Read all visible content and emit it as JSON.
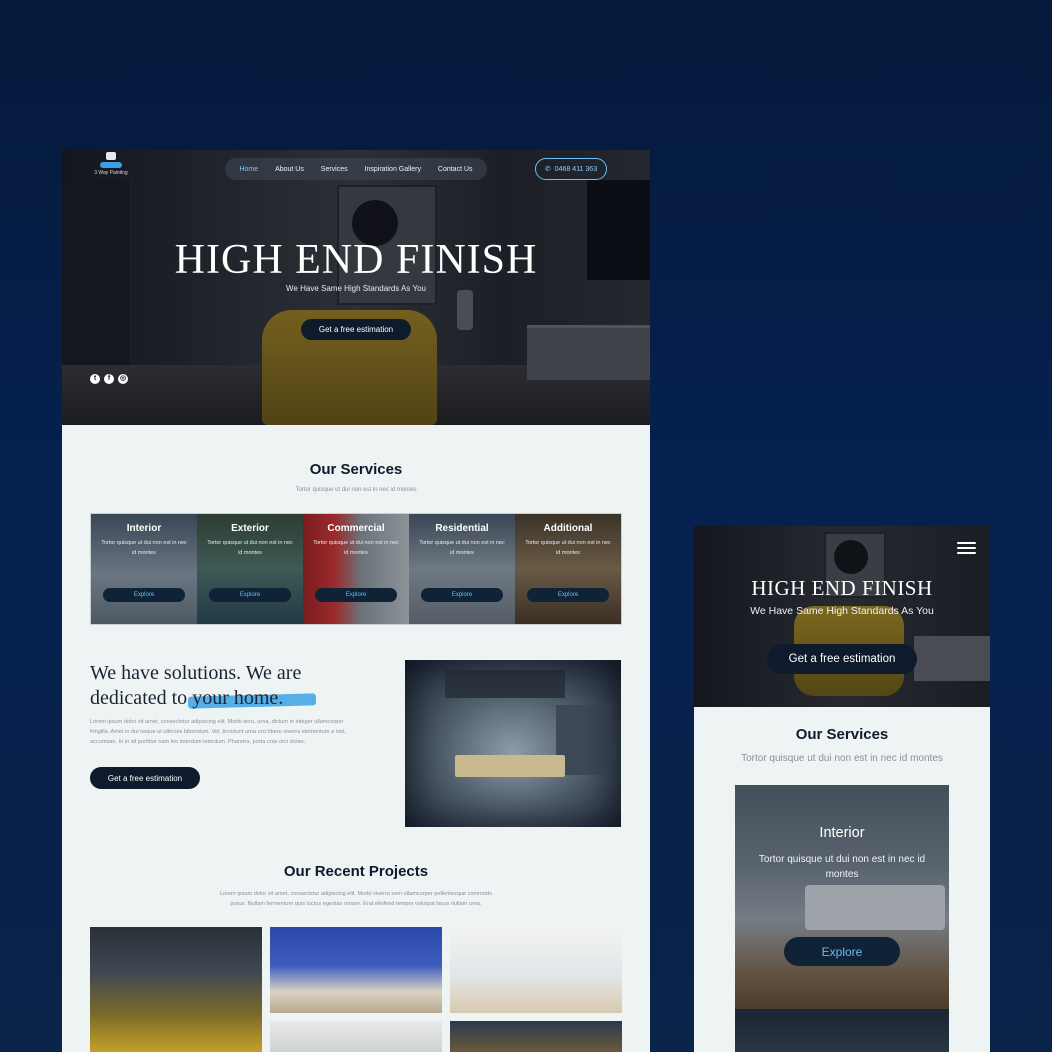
{
  "desktop": {
    "logo": {
      "text": "3 Way Painting"
    },
    "nav": [
      {
        "label": "Home",
        "active": true
      },
      {
        "label": "About Us"
      },
      {
        "label": "Services"
      },
      {
        "label": "Inspiration Gallery"
      },
      {
        "label": "Contact Us"
      }
    ],
    "phone": {
      "icon": "phone-icon",
      "label": "0468 411 363"
    },
    "hero": {
      "title": "HIGH END FINISH",
      "subtitle": "We Have Same High Standards As You",
      "cta": "Get a free estimation"
    },
    "socials": [
      {
        "name": "twitter-icon",
        "glyph": "t"
      },
      {
        "name": "facebook-icon",
        "glyph": "f"
      },
      {
        "name": "instagram-icon",
        "glyph": "◎"
      }
    ],
    "services": {
      "title": "Our Services",
      "subtitle": "Tortor quisque ut dui non est in nec id montes",
      "items": [
        {
          "title": "Interior",
          "text": "Tortor quisque ut dui non est in nec id montes",
          "button": "Explore",
          "tint": "#3a4654"
        },
        {
          "title": "Exterior",
          "text": "Tortor quisque ut dui non est in nec id montes",
          "button": "Explore",
          "tint": "#2f3d33"
        },
        {
          "title": "Commercial",
          "text": "Tortor quisque ut dui non est in nec id montes",
          "button": "Explore",
          "tint": "#5b1f22"
        },
        {
          "title": "Residential",
          "text": "Tortor quisque ut dui non est in nec id montes",
          "button": "Explore",
          "tint": "#3b4656"
        },
        {
          "title": "Additional",
          "text": "Tortor quisque ut dui non est in nec id montes",
          "button": "Explore",
          "tint": "#3b3328"
        }
      ]
    },
    "solutions": {
      "title_line1": "We have solutions. We are",
      "title_line2_prefix": "dedicated to ",
      "title_highlight": "your home.",
      "highlight_color": "#3aa3e4",
      "body": "Lorem ipsum dolor sit amet, consectetur adipiscing elit. Morbi arcu, urna, dictum in integer ullamcorper fringilla. Amet in dui neque ut ultricies bibendum. Vel, tincidunt urna orci libero viverra elementum a nisl, accumsan. In in sit porttitor nam leo interdum interdum. Pharetra, porta cras orci donec.",
      "cta": "Get a free estimation"
    },
    "projects": {
      "title": "Our Recent Projects",
      "subtitle": "Lorem ipsum dolor sit amet, consectetur adipiscing elit. Morbi viverra sem ullamcorper pellentesque commodo purus. Nullam fermentum quis luctus egestas ornare. Erat eleifend tempor volutpat lacus nullam urna."
    }
  },
  "mobile": {
    "menu_icon": "hamburger-menu-icon",
    "hero": {
      "title": "HIGH END FINISH",
      "subtitle": "We Have Same High Standards As You",
      "cta": "Get a free estimation"
    },
    "services": {
      "title": "Our Services",
      "subtitle": "Tortor quisque ut dui non est in nec id montes",
      "card": {
        "title": "Interior",
        "text": "Tortor quisque ut dui non est in nec id montes",
        "button": "Explore"
      }
    }
  },
  "colors": {
    "background": "#062150",
    "dark_button": "#0f1b2d",
    "accent": "#3aa3e4",
    "page": "#eef3f3"
  }
}
